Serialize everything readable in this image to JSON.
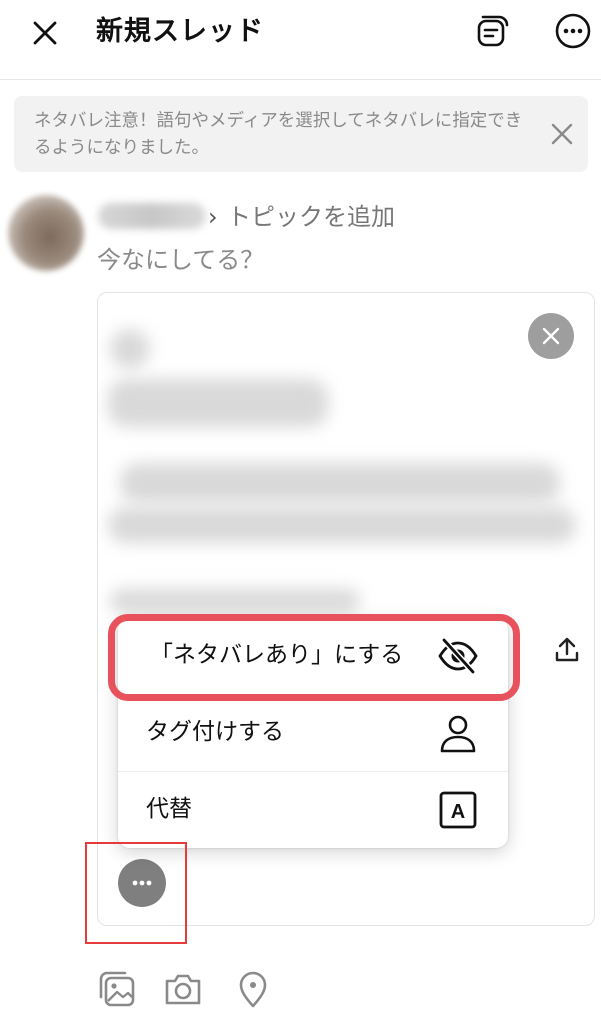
{
  "header": {
    "title": "新規スレッド",
    "close_icon": "close-icon",
    "drafts_icon": "drafts-icon",
    "more_icon": "more-icon"
  },
  "banner": {
    "text": "ネタバレ注意！語句やメディアを選択してネタバレに指定できるようになりました。",
    "dismiss_icon": "close-icon"
  },
  "composer": {
    "topic_chevron": "›",
    "topic_label": "トピックを追加",
    "placeholder": "今なにしてる？"
  },
  "attachment": {
    "remove_icon": "close-icon",
    "share_icon": "share-icon",
    "options_icon": "more-horizontal-icon"
  },
  "menu": {
    "items": [
      {
        "label": "「ネタバレあり」にする",
        "icon": "eye-slash-icon"
      },
      {
        "label": "タグ付けする",
        "icon": "person-icon"
      },
      {
        "label": "代替",
        "icon": "alt-text-icon",
        "icon_text": "A"
      }
    ]
  },
  "toolbar": {
    "items": [
      "gallery-icon",
      "camera-icon",
      "location-icon"
    ]
  },
  "colors": {
    "highlight_border": "#e8525c",
    "options_box": "#e53b3b",
    "muted_text": "#8a8a8a",
    "banner_bg": "#f2f2f2"
  }
}
